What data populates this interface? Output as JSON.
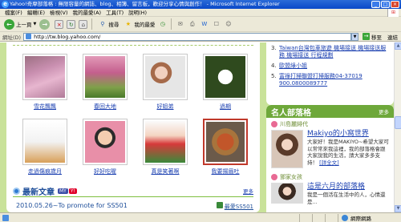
{
  "window": {
    "title": "Yahoo!奇摩部落格 : 無限容量的網誌、blog、相簿、留言板，歡迎分享心情與創作！ - Microsoft Internet Explorer",
    "minimize": "_",
    "maximize": "□",
    "close": "×"
  },
  "menu": {
    "items": [
      "檔案(F)",
      "編輯(E)",
      "檢視(V)",
      "我的最愛(A)",
      "工具(T)",
      "說明(H)"
    ]
  },
  "toolbar": {
    "back_label": "上一頁",
    "search_label": "搜尋",
    "favorites_label": "我的最愛"
  },
  "address": {
    "label": "網址(D)",
    "url": "http://tw.blog.yahoo.com/",
    "go_label": "移至",
    "links_label": "連結"
  },
  "gallery": {
    "items": [
      {
        "caption": "雪花飄飄"
      },
      {
        "caption": "春回大地"
      },
      {
        "caption": "好姐弟"
      },
      {
        "caption": "過期"
      },
      {
        "caption": "走過傷痕歲月"
      },
      {
        "caption": "好好吃喔"
      },
      {
        "caption": "真是笑著啊"
      },
      {
        "caption": "我要揚眉吐"
      }
    ]
  },
  "latest": {
    "title": "最新文章",
    "badge1": "MY",
    "badge2": "Y!",
    "more": "更多",
    "article_date_title": "2010.05.26~To promote for SS501",
    "article_author": "最愛SS501"
  },
  "right_top": {
    "items": [
      {
        "num": "3.",
        "text": "Taiwan台灣包車旅遊 機場接送 機場接送服務 機場接送 行程規劃"
      },
      {
        "num": "4.",
        "text": "歐盟綠小姐"
      },
      {
        "num": "5.",
        "text": "富祿打掃聯盟打掃服務04-37019 900.0800089777"
      }
    ]
  },
  "popular": {
    "title": "名人部落格",
    "more": "更多",
    "blog_name": "川島麗緋代",
    "entry_title": "Makiyo的小窩世界",
    "entry_body": "大家好！我是MAKIYO~希望大家可以常常來我這裡，我的部落格會跟大家說我的生活，請大家多多支持！",
    "entry_more": "[詳全文]",
    "blog_name2": "鄧家女孩",
    "entry_title2": "這是六月的部落格",
    "entry_body2": "我是一個活在生活中的人，心情還是..."
  },
  "status": {
    "zone": "網際網路"
  }
}
